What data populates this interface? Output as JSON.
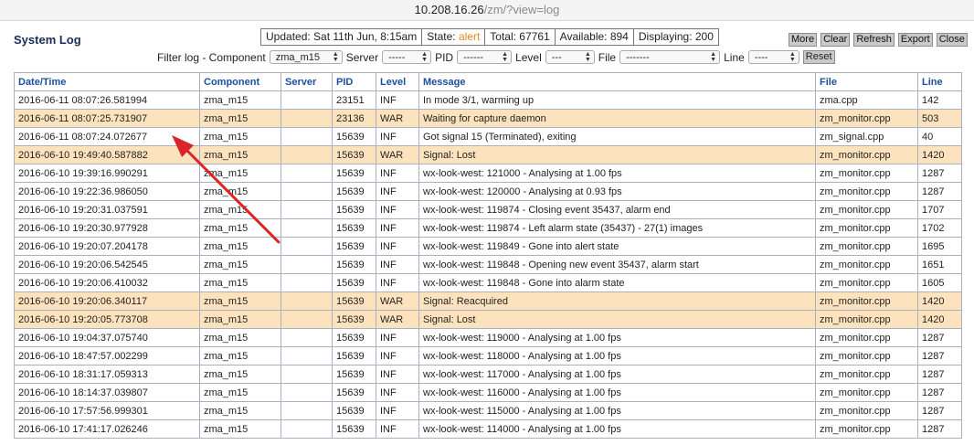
{
  "browser": {
    "host": "10.208.16.26",
    "path": "/zm/?view=log"
  },
  "page": {
    "title": "System Log"
  },
  "status": {
    "updated": "Updated: Sat 11th Jun, 8:15am",
    "state_label": "State:",
    "state_value": "alert",
    "total": "Total: 67761",
    "available": "Available: 894",
    "displaying": "Displaying: 200"
  },
  "actions": {
    "more": "More",
    "clear": "Clear",
    "refresh": "Refresh",
    "export": "Export",
    "close": "Close"
  },
  "filters": {
    "title": "Filter log - Component",
    "component": "zma_m15",
    "server_label": "Server",
    "server": "-----",
    "pid_label": "PID",
    "pid": "------",
    "level_label": "Level",
    "level": "---",
    "file_label": "File",
    "file": "-------",
    "line_label": "Line",
    "line": "----",
    "reset": "Reset"
  },
  "table": {
    "headers": [
      "Date/Time",
      "Component",
      "Server",
      "PID",
      "Level",
      "Message",
      "File",
      "Line"
    ],
    "rows": [
      [
        "2016-06-11 08:07:26.581994",
        "zma_m15",
        "",
        "23151",
        "INF",
        "In mode 3/1, warming up",
        "zma.cpp",
        "142"
      ],
      [
        "2016-06-11 08:07:25.731907",
        "zma_m15",
        "",
        "23136",
        "WAR",
        "Waiting for capture daemon",
        "zm_monitor.cpp",
        "503"
      ],
      [
        "2016-06-11 08:07:24.072677",
        "zma_m15",
        "",
        "15639",
        "INF",
        "Got signal 15 (Terminated), exiting",
        "zm_signal.cpp",
        "40"
      ],
      [
        "2016-06-10 19:49:40.587882",
        "zma_m15",
        "",
        "15639",
        "WAR",
        "Signal: Lost",
        "zm_monitor.cpp",
        "1420"
      ],
      [
        "2016-06-10 19:39:16.990291",
        "zma_m15",
        "",
        "15639",
        "INF",
        "wx-look-west: 121000 - Analysing at 1.00 fps",
        "zm_monitor.cpp",
        "1287"
      ],
      [
        "2016-06-10 19:22:36.986050",
        "zma_m15",
        "",
        "15639",
        "INF",
        "wx-look-west: 120000 - Analysing at 0.93 fps",
        "zm_monitor.cpp",
        "1287"
      ],
      [
        "2016-06-10 19:20:31.037591",
        "zma_m15",
        "",
        "15639",
        "INF",
        "wx-look-west: 119874 - Closing event 35437, alarm end",
        "zm_monitor.cpp",
        "1707"
      ],
      [
        "2016-06-10 19:20:30.977928",
        "zma_m15",
        "",
        "15639",
        "INF",
        "wx-look-west: 119874 - Left alarm state (35437) - 27(1) images",
        "zm_monitor.cpp",
        "1702"
      ],
      [
        "2016-06-10 19:20:07.204178",
        "zma_m15",
        "",
        "15639",
        "INF",
        "wx-look-west: 119849 - Gone into alert state",
        "zm_monitor.cpp",
        "1695"
      ],
      [
        "2016-06-10 19:20:06.542545",
        "zma_m15",
        "",
        "15639",
        "INF",
        "wx-look-west: 119848 - Opening new event 35437, alarm start",
        "zm_monitor.cpp",
        "1651"
      ],
      [
        "2016-06-10 19:20:06.410032",
        "zma_m15",
        "",
        "15639",
        "INF",
        "wx-look-west: 119848 - Gone into alarm state",
        "zm_monitor.cpp",
        "1605"
      ],
      [
        "2016-06-10 19:20:06.340117",
        "zma_m15",
        "",
        "15639",
        "WAR",
        "Signal: Reacquired",
        "zm_monitor.cpp",
        "1420"
      ],
      [
        "2016-06-10 19:20:05.773708",
        "zma_m15",
        "",
        "15639",
        "WAR",
        "Signal: Lost",
        "zm_monitor.cpp",
        "1420"
      ],
      [
        "2016-06-10 19:04:37.075740",
        "zma_m15",
        "",
        "15639",
        "INF",
        "wx-look-west: 119000 - Analysing at 1.00 fps",
        "zm_monitor.cpp",
        "1287"
      ],
      [
        "2016-06-10 18:47:57.002299",
        "zma_m15",
        "",
        "15639",
        "INF",
        "wx-look-west: 118000 - Analysing at 1.00 fps",
        "zm_monitor.cpp",
        "1287"
      ],
      [
        "2016-06-10 18:31:17.059313",
        "zma_m15",
        "",
        "15639",
        "INF",
        "wx-look-west: 117000 - Analysing at 1.00 fps",
        "zm_monitor.cpp",
        "1287"
      ],
      [
        "2016-06-10 18:14:37.039807",
        "zma_m15",
        "",
        "15639",
        "INF",
        "wx-look-west: 116000 - Analysing at 1.00 fps",
        "zm_monitor.cpp",
        "1287"
      ],
      [
        "2016-06-10 17:57:56.999301",
        "zma_m15",
        "",
        "15639",
        "INF",
        "wx-look-west: 115000 - Analysing at 1.00 fps",
        "zm_monitor.cpp",
        "1287"
      ],
      [
        "2016-06-10 17:41:17.026246",
        "zma_m15",
        "",
        "15639",
        "INF",
        "wx-look-west: 114000 - Analysing at 1.00 fps",
        "zm_monitor.cpp",
        "1287"
      ]
    ]
  },
  "colors": {
    "warn_row": "#fde3bd",
    "header_text": "#1c4fa3",
    "alert": "#e58a2a",
    "annotation_arrow": "#d9252a"
  }
}
